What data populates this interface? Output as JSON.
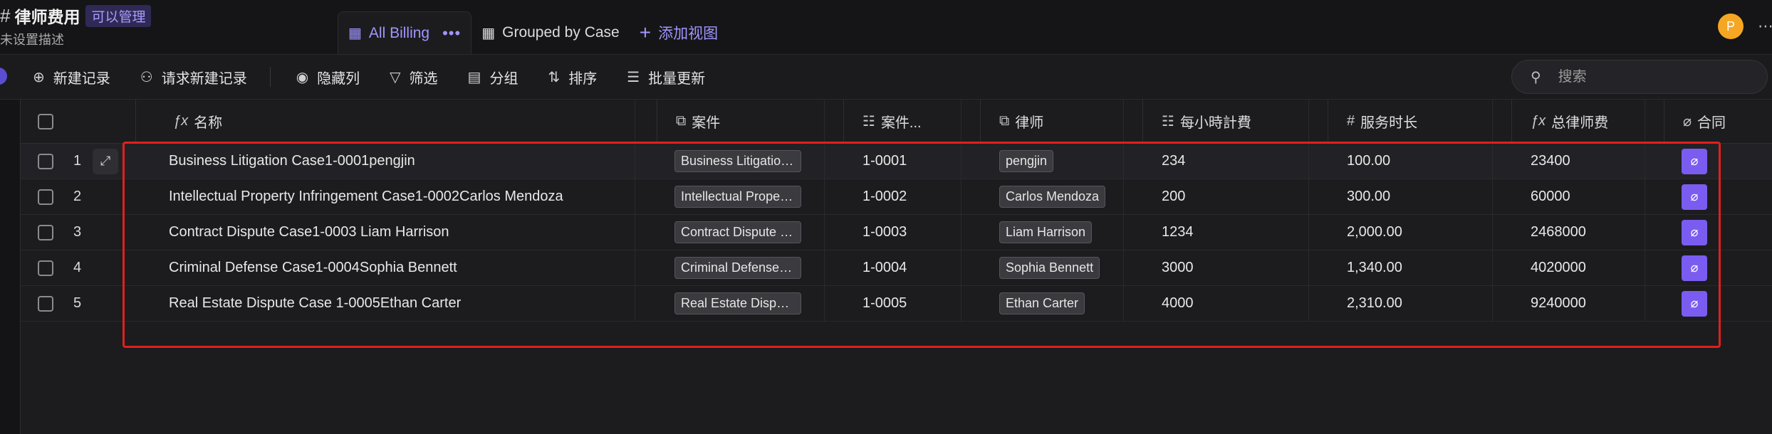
{
  "header": {
    "title": "律师费用",
    "permission_badge": "可以管理",
    "description": "未设置描述",
    "avatar_letter": "P"
  },
  "tabs": [
    {
      "label": "All Billing",
      "active": true
    },
    {
      "label": "Grouped by Case",
      "active": false
    }
  ],
  "add_view_label": "添加视图",
  "toolbar": {
    "new_record": "新建记录",
    "request_new_record": "请求新建记录",
    "hide_columns": "隐藏列",
    "filter": "筛选",
    "group": "分组",
    "sort": "排序",
    "bulk_update": "批量更新",
    "search_placeholder": "搜索"
  },
  "columns": [
    "名称",
    "案件",
    "案件...",
    "律师",
    "每小時計費",
    "服务时长",
    "总律师费",
    "合同"
  ],
  "rows": [
    {
      "num": "1",
      "name": "Business Litigation Case1-0001pengjin",
      "case": "Business Litigation ...",
      "case_no": "1-0001",
      "lawyer": "pengjin",
      "rate": "234",
      "hours": "100.00",
      "fee": "23400"
    },
    {
      "num": "2",
      "name": "Intellectual Property Infringement Case1-0002Carlos Mendoza",
      "case": "Intellectual Propert...",
      "case_no": "1-0002",
      "lawyer": "Carlos Mendoza",
      "rate": "200",
      "hours": "300.00",
      "fee": "60000"
    },
    {
      "num": "3",
      "name": "Contract Dispute Case1-0003 Liam Harrison",
      "case": "Contract Dispute C...",
      "case_no": "1-0003",
      "lawyer": "Liam Harrison",
      "rate": "1234",
      "hours": "2,000.00",
      "fee": "2468000"
    },
    {
      "num": "4",
      "name": "Criminal Defense Case1-0004Sophia Bennett",
      "case": "Criminal Defense C...",
      "case_no": "1-0004",
      "lawyer": "Sophia Bennett",
      "rate": "3000",
      "hours": "1,340.00",
      "fee": "4020000"
    },
    {
      "num": "5",
      "name": "Real Estate Dispute Case 1-0005Ethan Carter",
      "case": "Real Estate Dispute...",
      "case_no": "1-0005",
      "lawyer": "Ethan Carter",
      "rate": "4000",
      "hours": "2,310.00",
      "fee": "9240000"
    }
  ],
  "colors": {
    "accent": "#9f96ff",
    "attachment": "#7b5cf0",
    "highlight": "#e0201c"
  }
}
